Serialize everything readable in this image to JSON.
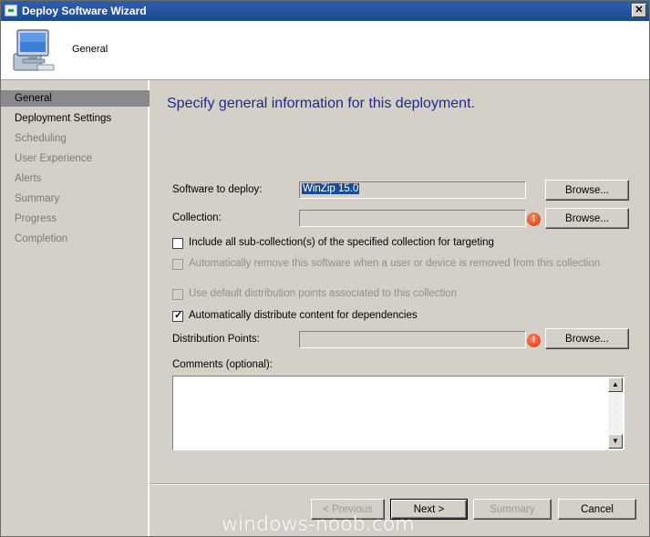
{
  "window": {
    "title": "Deploy Software Wizard",
    "close_label": "✕"
  },
  "header": {
    "title": "General",
    "icon": "computer-icon"
  },
  "sidebar": {
    "items": [
      {
        "label": "General",
        "state": "active"
      },
      {
        "label": "Deployment Settings",
        "state": "enabled"
      },
      {
        "label": "Scheduling",
        "state": "disabled"
      },
      {
        "label": "User Experience",
        "state": "disabled"
      },
      {
        "label": "Alerts",
        "state": "disabled"
      },
      {
        "label": "Summary",
        "state": "disabled"
      },
      {
        "label": "Progress",
        "state": "disabled"
      },
      {
        "label": "Completion",
        "state": "disabled"
      }
    ]
  },
  "main": {
    "heading": "Specify general information for this deployment.",
    "software": {
      "label": "Software to deploy:",
      "value": "WinZip 15.0",
      "browse_label": "Browse..."
    },
    "collection": {
      "label": "Collection:",
      "value": "",
      "browse_label": "Browse..."
    },
    "include_subcollections": {
      "label": "Include all sub-collection(s) of the specified collection for targeting",
      "checked": false
    },
    "auto_remove": {
      "label": "Automatically remove this software when a user or device is removed from this collection",
      "checked": false,
      "enabled": false
    },
    "use_default_dp": {
      "label": "Use default distribution points associated to this collection",
      "checked": false,
      "enabled": false
    },
    "auto_distribute": {
      "label": "Automatically distribute content for dependencies",
      "checked": true,
      "check_glyph": "✓"
    },
    "distribution_points": {
      "label": "Distribution Points:",
      "value": "",
      "browse_label": "Browse..."
    },
    "comments": {
      "label": "Comments (optional):",
      "value": ""
    },
    "error_glyph": "!"
  },
  "footer": {
    "previous_label": "< Previous",
    "next_label": "Next >",
    "summary_label": "Summary",
    "cancel_label": "Cancel"
  },
  "watermark": "windows-noob.com",
  "colors": {
    "titlebar": "#1c4a93",
    "heading": "#1f2a8c",
    "error": "#d8300a",
    "active_nav": "#8a8a8a"
  }
}
